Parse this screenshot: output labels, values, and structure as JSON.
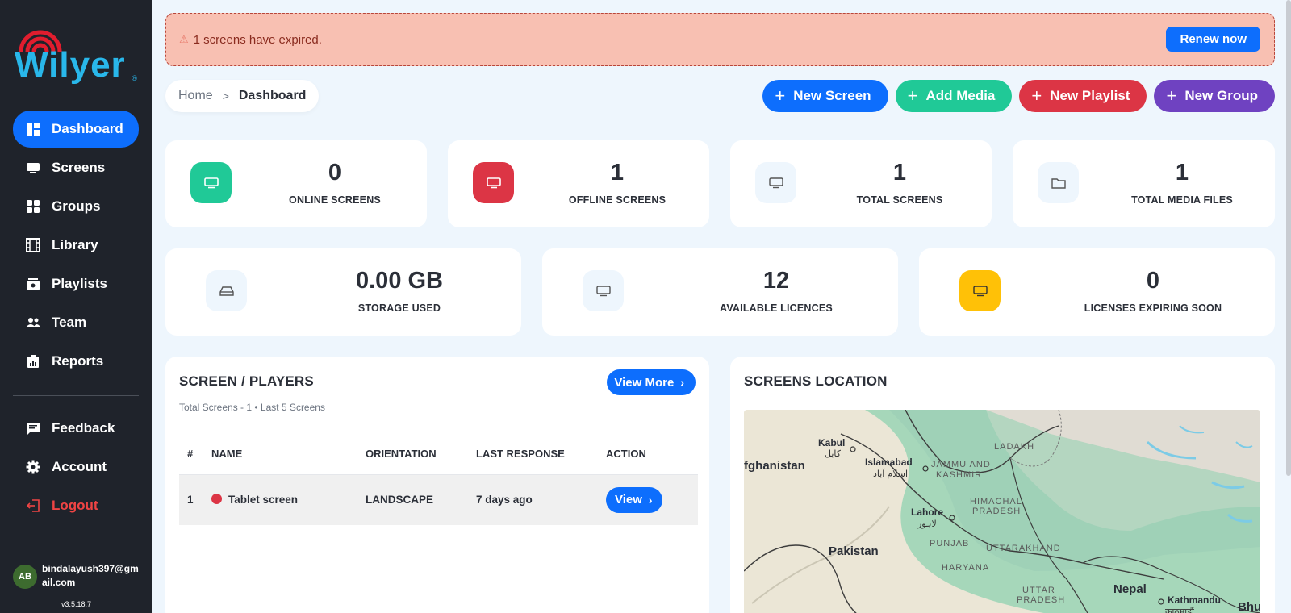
{
  "brand": {
    "name": "Wilyer",
    "registered": "®",
    "color": "#29b7ea"
  },
  "sidebar": {
    "items": [
      {
        "label": "Dashboard",
        "icon": "dashboard-icon",
        "active": true
      },
      {
        "label": "Screens",
        "icon": "screen-icon"
      },
      {
        "label": "Groups",
        "icon": "grid-icon"
      },
      {
        "label": "Library",
        "icon": "film-icon"
      },
      {
        "label": "Playlists",
        "icon": "playlist-icon"
      },
      {
        "label": "Team",
        "icon": "users-icon"
      },
      {
        "label": "Reports",
        "icon": "report-icon"
      }
    ],
    "bottom_items": [
      {
        "label": "Feedback",
        "icon": "feedback-icon"
      },
      {
        "label": "Account",
        "icon": "gear-icon"
      },
      {
        "label": "Logout",
        "icon": "logout-icon"
      }
    ],
    "user": {
      "initials": "AB",
      "email": "bindalayush397@gmail.com"
    },
    "version": "v3.5.18.7"
  },
  "alert": {
    "text": "1 screens have expired.",
    "button": "Renew now"
  },
  "breadcrumb": {
    "home": "Home",
    "separator": ">",
    "current": "Dashboard"
  },
  "actions": [
    {
      "label": "New Screen",
      "color": "#0d6efd"
    },
    {
      "label": "Add Media",
      "color": "#20c997"
    },
    {
      "label": "New Playlist",
      "color": "#dc3545"
    },
    {
      "label": "New Group",
      "color": "#6f42c1"
    }
  ],
  "stats_row1": [
    {
      "value": "0",
      "label": "ONLINE SCREENS",
      "icon": "monitor-icon",
      "color": "#20c997"
    },
    {
      "value": "1",
      "label": "OFFLINE SCREENS",
      "icon": "monitor-icon",
      "color": "#dc3545"
    },
    {
      "value": "1",
      "label": "TOTAL SCREENS",
      "icon": "monitor-icon",
      "color": "#eef6fd"
    },
    {
      "value": "1",
      "label": "TOTAL MEDIA FILES",
      "icon": "folder-icon",
      "color": "#eef6fd"
    }
  ],
  "stats_row2": [
    {
      "value": "0.00 GB",
      "label": "STORAGE USED",
      "icon": "drive-icon",
      "color": "#eef6fd"
    },
    {
      "value": "12",
      "label": "AVAILABLE LICENCES",
      "icon": "monitor-icon",
      "color": "#eef6fd"
    },
    {
      "value": "0",
      "label": "LICENSES EXPIRING SOON",
      "icon": "monitor-icon",
      "color": "#ffc107"
    }
  ],
  "players": {
    "title": "SCREEN / PLAYERS",
    "subtitle": "Total Screens - 1  •  Last 5 Screens",
    "view_more": "View More",
    "columns": [
      "#",
      "NAME",
      "ORIENTATION",
      "LAST RESPONSE",
      "ACTION"
    ],
    "rows": [
      {
        "index": "1",
        "name": "Tablet screen",
        "status": "offline",
        "orientation": "LANDSCAPE",
        "last_response": "7 days ago",
        "action": "View"
      }
    ]
  },
  "location": {
    "title": "SCREENS LOCATION",
    "labels": {
      "kabul": "Kabul",
      "kabul_local": "کابل",
      "afghanistan": "fghanistan",
      "islamabad": "Islamabad",
      "islamabad_local": "اسلام آباد",
      "ladakh": "LADAKH",
      "jk1": "JAMMU AND",
      "jk2": "KASHMIR",
      "hp1": "HIMACHAL",
      "hp2": "PRADESH",
      "lahore": "Lahore",
      "lahore_local": "لاہور",
      "pakistan": "Pakistan",
      "punjab": "PUNJAB",
      "uttarakhand": "UTTARAKHAND",
      "haryana": "HARYANA",
      "up1": "UTTAR",
      "up2": "PRADESH",
      "nepal": "Nepal",
      "kathmandu": "Kathmandu",
      "kathmandu_local": "काठमाडौं",
      "bhu": "Bhu"
    }
  }
}
